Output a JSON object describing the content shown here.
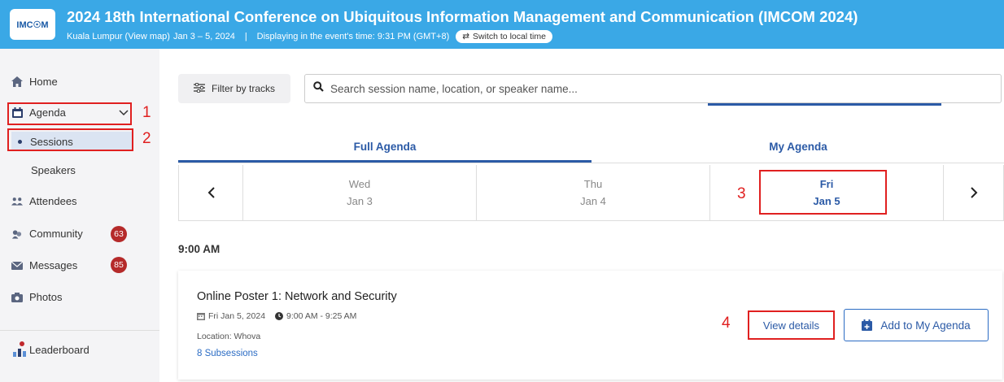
{
  "header": {
    "logo_text": "IMC☉M",
    "title": "2024 18th International Conference on Ubiquitous Information Management and Communication (IMCOM 2024)",
    "location": "Kuala Lumpur (View map)",
    "dates": "Jan 3 – 5, 2024",
    "separator": "|",
    "time_display": "Displaying in the event's time: 9:31 PM (GMT+8)",
    "switch_label": "Switch to local time"
  },
  "sidebar": {
    "home": "Home",
    "agenda": "Agenda",
    "sessions": "Sessions",
    "speakers": "Speakers",
    "attendees": "Attendees",
    "community": "Community",
    "community_count": "63",
    "messages": "Messages",
    "messages_count": "85",
    "photos": "Photos",
    "leaderboard": "Leaderboard"
  },
  "annotations": {
    "n1": "1",
    "n2": "2",
    "n3": "3",
    "n4": "4"
  },
  "toolbar": {
    "filter_label": "Filter by tracks",
    "search_placeholder": "Search session name, location, or speaker name..."
  },
  "tabs": {
    "full": "Full Agenda",
    "my": "My Agenda"
  },
  "days": [
    {
      "weekday": "Wed",
      "date": "Jan 3"
    },
    {
      "weekday": "Thu",
      "date": "Jan 4"
    },
    {
      "weekday": "Fri",
      "date": "Jan 5"
    }
  ],
  "time_slot": "9:00 AM",
  "session": {
    "title": "Online Poster 1: Network and Security",
    "date": "Fri Jan 5, 2024",
    "time": "9:00 AM - 9:25 AM",
    "location": "Location: Whova",
    "subsessions": "8 Subsessions",
    "view_label": "View details",
    "add_label": "Add to My Agenda"
  },
  "colors": {
    "header_bg": "#3aa8e6",
    "accent": "#2b5aa6",
    "badge": "#b52a2a",
    "annotation": "#e02020"
  }
}
